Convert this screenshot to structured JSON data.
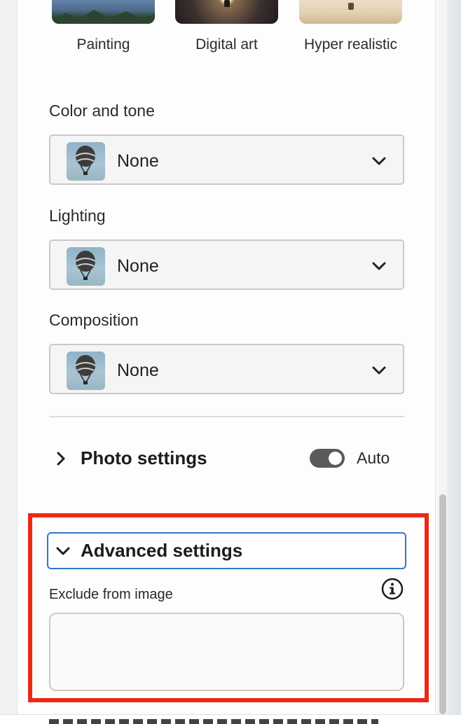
{
  "styles": {
    "items": [
      {
        "label": "Painting"
      },
      {
        "label": "Digital art"
      },
      {
        "label": "Hyper realistic"
      }
    ]
  },
  "color_tone": {
    "label": "Color and tone",
    "value": "None",
    "thumb_icon": "hot-air-balloon-icon",
    "chevron_icon": "chevron-down-icon"
  },
  "lighting": {
    "label": "Lighting",
    "value": "None",
    "thumb_icon": "hot-air-balloon-icon",
    "chevron_icon": "chevron-down-icon"
  },
  "composition": {
    "label": "Composition",
    "value": "None",
    "thumb_icon": "hot-air-balloon-icon",
    "chevron_icon": "chevron-down-icon"
  },
  "photo_settings": {
    "title": "Photo settings",
    "toggle_label": "Auto",
    "toggle_on": true,
    "chevron_icon": "chevron-right-icon"
  },
  "advanced_settings": {
    "title": "Advanced settings",
    "chevron_icon": "chevron-down-icon",
    "exclude_label": "Exclude from image",
    "exclude_value": "",
    "info_icon": "info-icon"
  },
  "colors": {
    "highlight": "#ea2a14",
    "focus_ring": "#2f79c8",
    "toggle_on": "#5a5a5a"
  }
}
